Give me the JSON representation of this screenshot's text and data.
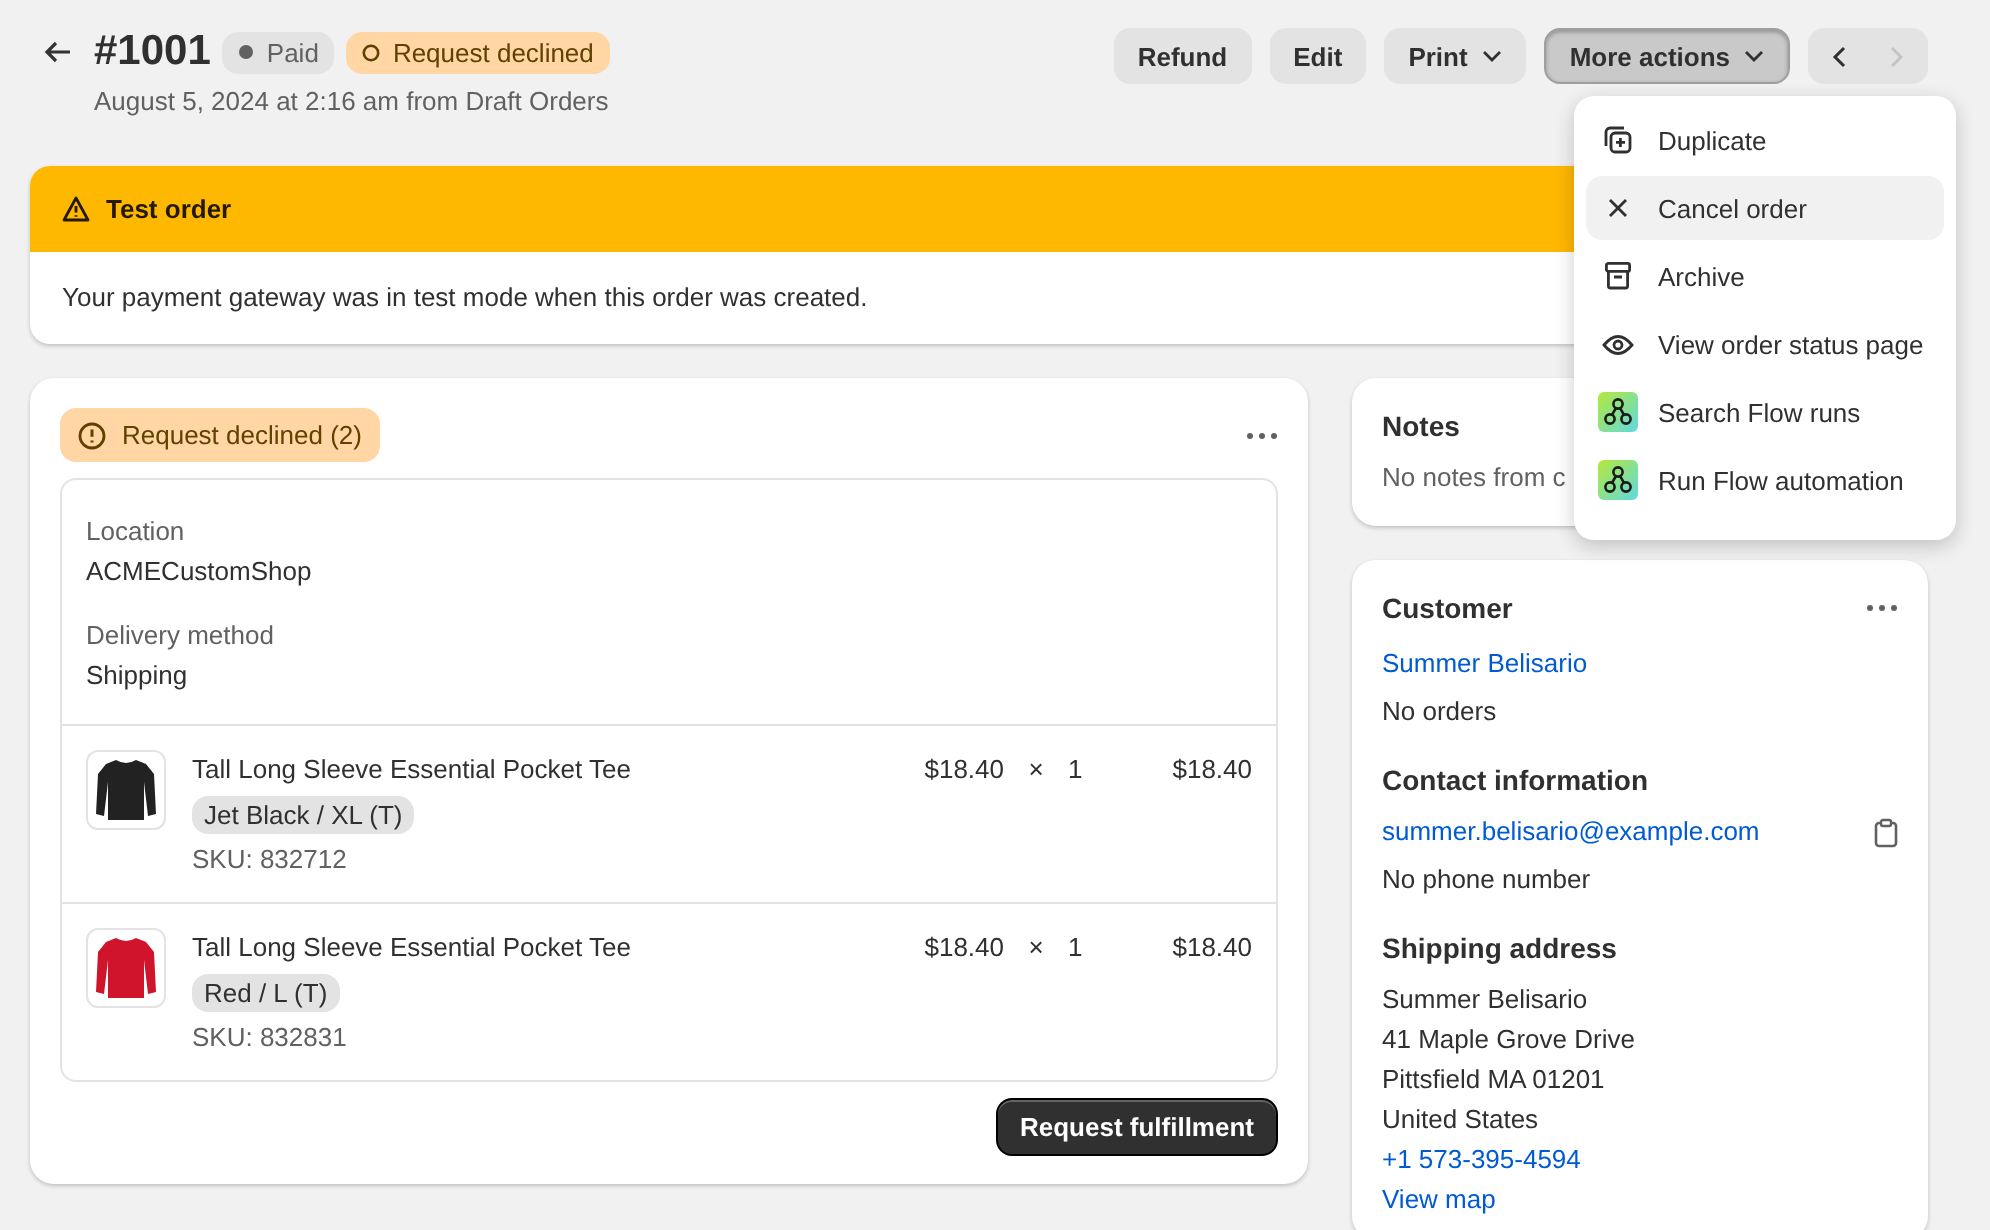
{
  "header": {
    "title": "#1001",
    "badges": [
      {
        "label": "Paid",
        "kind": "payment"
      },
      {
        "label": "Request declined",
        "kind": "fulfillment"
      }
    ],
    "subtitle": "August 5, 2024 at 2:16 am from Draft Orders",
    "actions": [
      {
        "label": "Refund",
        "kind": "plain",
        "pressed": false
      },
      {
        "label": "Edit",
        "kind": "plain",
        "pressed": false
      },
      {
        "label": "Print",
        "kind": "dropdown",
        "pressed": false
      },
      {
        "label": "More actions",
        "kind": "dropdown",
        "pressed": true
      }
    ],
    "pager": {
      "previous_disabled": false,
      "next_disabled": true
    }
  },
  "menu": [
    {
      "label": "Duplicate",
      "selected": false
    },
    {
      "label": "Cancel order",
      "selected": true
    },
    {
      "label": "Archive",
      "selected": false
    },
    {
      "label": "View order status page",
      "selected": false
    },
    {
      "label": "Search Flow runs",
      "selected": false
    },
    {
      "label": "Run Flow automation",
      "selected": false
    }
  ],
  "banner": {
    "title": "Test order",
    "message": "Your payment gateway was in test mode when this order was created."
  },
  "fulfillment": {
    "status": "Request declined (2)",
    "location_label": "Location",
    "location": "ACMECustomShop",
    "delivery_label": "Delivery method",
    "delivery": "Shipping",
    "items": [
      {
        "name": "Tall Long Sleeve Essential Pocket Tee",
        "variant": "Jet Black / XL (T)",
        "sku": "SKU: 832712",
        "price": "$18.40",
        "times": "×",
        "quantity": "1",
        "total": "$18.40",
        "color": "#222222"
      },
      {
        "name": "Tall Long Sleeve Essential Pocket Tee",
        "variant": "Red / L (T)",
        "sku": "SKU: 832831",
        "price": "$18.40",
        "times": "×",
        "quantity": "1",
        "total": "$18.40",
        "color": "#d0142c"
      }
    ],
    "button": "Request fulfillment"
  },
  "notes": {
    "title": "Notes",
    "text": "No notes from c"
  },
  "customer": {
    "title": "Customer",
    "name": "Summer Belisario",
    "orders": "No orders",
    "contact_title": "Contact information",
    "email": "summer.belisario@example.com",
    "phone": "No phone number",
    "shipping_title": "Shipping address",
    "address": [
      "Summer Belisario",
      "41 Maple Grove Drive",
      "Pittsfield MA 01201",
      "United States"
    ],
    "address_phone": "+1 573-395-4594",
    "map_link": "View map"
  }
}
